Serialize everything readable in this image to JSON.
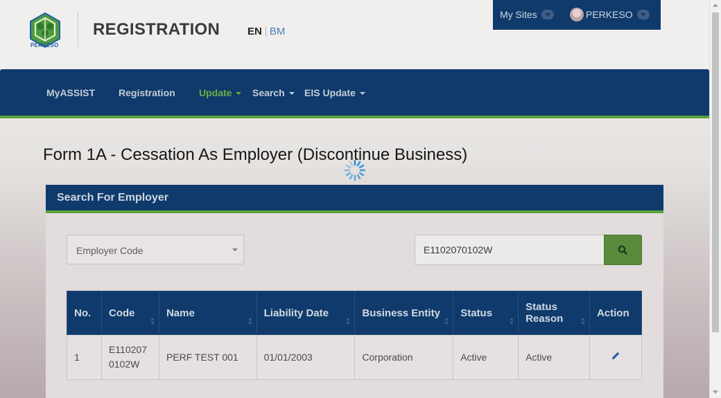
{
  "header": {
    "logo_text": "PERKESO",
    "title": "REGISTRATION",
    "lang_en": "EN",
    "lang_bm": "BM",
    "my_sites": "My Sites",
    "user": "PERKESO"
  },
  "nav": {
    "items": [
      {
        "label": "MyASSIST",
        "active": false,
        "dropdown": false
      },
      {
        "label": "Registration",
        "active": false,
        "dropdown": false
      },
      {
        "label": "Update",
        "active": true,
        "dropdown": true
      },
      {
        "label": "Search",
        "active": false,
        "dropdown": true
      },
      {
        "label": "EIS Update",
        "active": false,
        "dropdown": true
      }
    ]
  },
  "page_title": "Form 1A - Cessation As Employer (Discontinue Business)",
  "panel": {
    "title": "Search For Employer",
    "select_value": "Employer Code",
    "search_value": "E1102070102W"
  },
  "table": {
    "headers": [
      "No.",
      "Code",
      "Name",
      "Liability Date",
      "Business Entity",
      "Status",
      "Status Reason",
      "Action"
    ],
    "rows": [
      {
        "no": "1",
        "code_line1": "E110207",
        "code_line2": "0102W",
        "name": "PERF TEST 001",
        "liability_date": "01/01/2003",
        "business_entity": "Corporation",
        "status": "Active",
        "status_reason": "Active",
        "action_icon": "edit-pencil-icon"
      }
    ]
  },
  "colors": {
    "navy": "#0f3a6b",
    "green_accent": "#5aa33a",
    "search_button": "#5a8a3b"
  }
}
